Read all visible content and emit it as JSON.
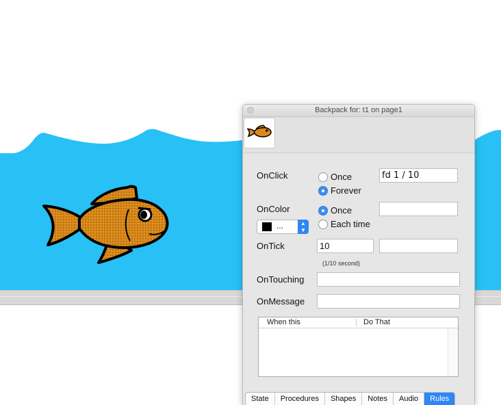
{
  "window": {
    "title": "Backpack for: t1 on page1"
  },
  "rules": {
    "onclick": {
      "label": "OnClick",
      "options": [
        "Once",
        "Forever"
      ],
      "selected": "Forever",
      "command": "fd 1 / 10"
    },
    "oncolor": {
      "label": "OnColor",
      "options": [
        "Once",
        "Each time"
      ],
      "selected": "Once",
      "color_value": "...",
      "swatch_color": "#000000",
      "command": ""
    },
    "ontick": {
      "label": "OnTick",
      "value": "10",
      "unit_note": "(1/10 second)",
      "command": ""
    },
    "ontouching": {
      "label": "OnTouching",
      "value": ""
    },
    "onmessage": {
      "label": "OnMessage",
      "value": ""
    }
  },
  "rules_table": {
    "columns": [
      "When this",
      "Do That"
    ],
    "rows": []
  },
  "tabs": [
    {
      "label": "State",
      "active": false
    },
    {
      "label": "Procedures",
      "active": false
    },
    {
      "label": "Shapes",
      "active": false
    },
    {
      "label": "Notes",
      "active": false
    },
    {
      "label": "Audio",
      "active": false
    },
    {
      "label": "Rules",
      "active": true
    }
  ],
  "colors": {
    "water": "#28c0f5",
    "fish_body": "#d98a1a",
    "accent": "#2f86f5"
  },
  "icons": {
    "thumbnail": "goldfish-icon",
    "close": "close-icon"
  }
}
